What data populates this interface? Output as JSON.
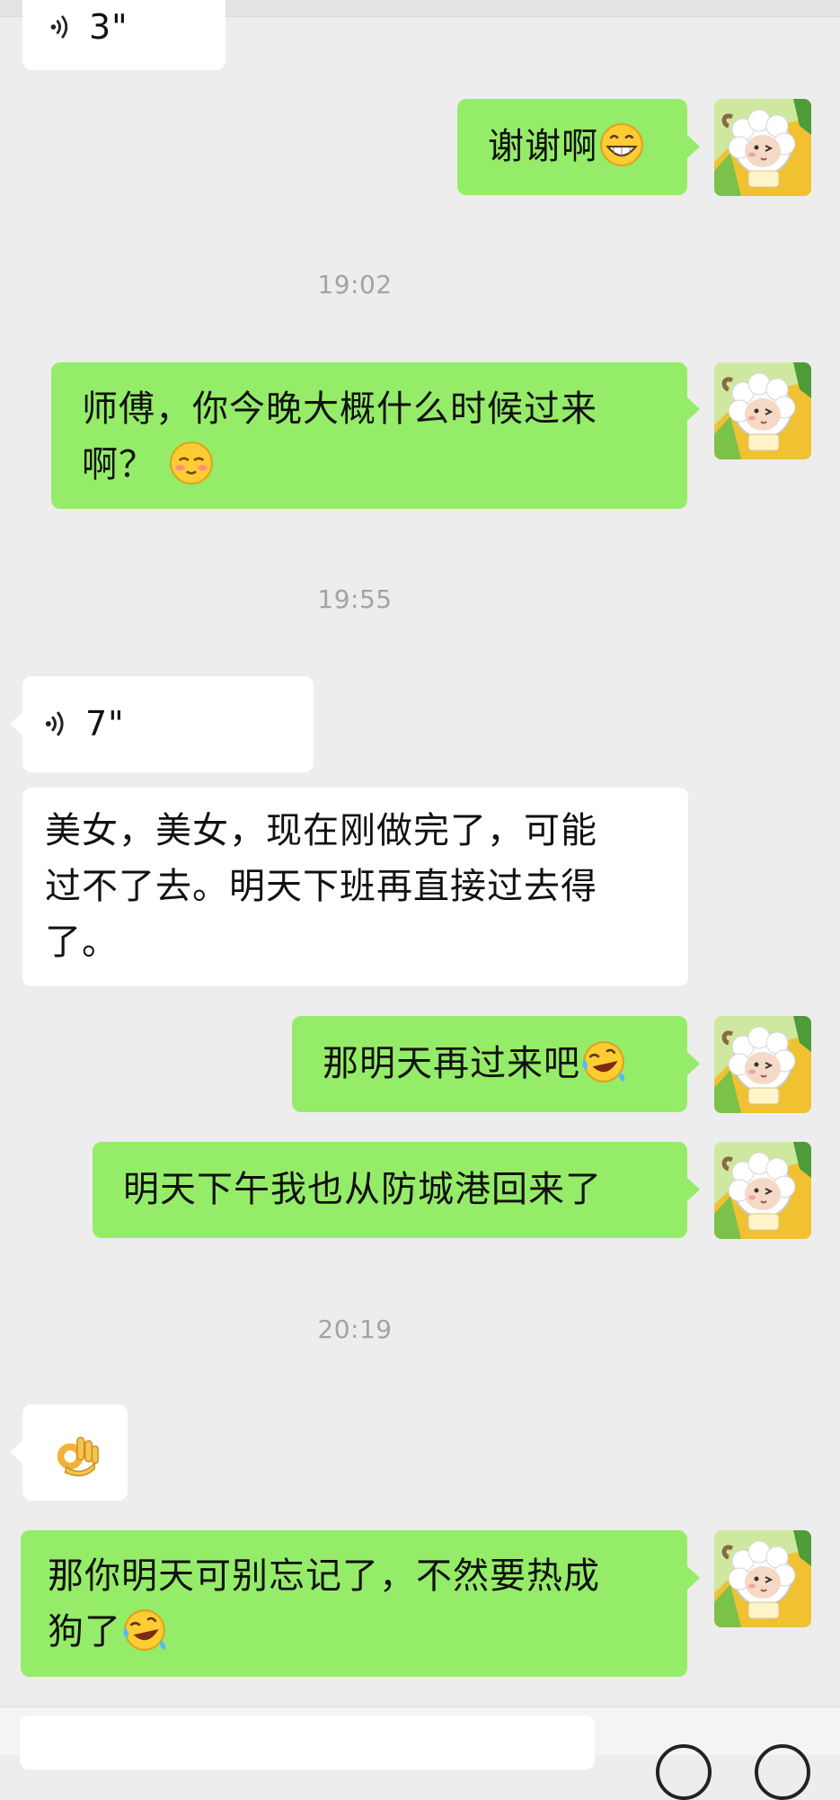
{
  "messages": {
    "voice_top": {
      "duration": "3\""
    },
    "m1": {
      "text": "谢谢啊"
    },
    "time1": "19:02",
    "m2": {
      "line1": "师傅，你今晚大概什么时候过来",
      "line2": "啊？"
    },
    "time2": "19:55",
    "voice2": {
      "duration": "7\""
    },
    "m3": {
      "line1": "美女，美女，现在刚做完了，可能",
      "line2": "过不了去。明天下班再直接过去得",
      "line3": "了。"
    },
    "m4": {
      "text": "那明天再过来吧"
    },
    "m5": {
      "text": "明天下午我也从防城港回来了"
    },
    "time3": "20:19",
    "m6": {
      "emoji": "ok-hand"
    },
    "m7": {
      "line1": "那你明天可别忘记了，不然要热成",
      "line2": "狗了"
    }
  },
  "icons": {
    "voice": "voice-wave-icon",
    "grin": "grinning-emoji-icon",
    "pleading": "pleading-emoji-icon",
    "laughing_crying": "rolling-laughing-emoji-icon",
    "ok": "ok-hand-emoji-icon",
    "avatar": "lamb-cartoon-avatar"
  },
  "colors": {
    "background": "#ededed",
    "outgoing_bubble": "#95ec69",
    "incoming_bubble": "#ffffff",
    "timestamp": "#a3a3a3"
  }
}
